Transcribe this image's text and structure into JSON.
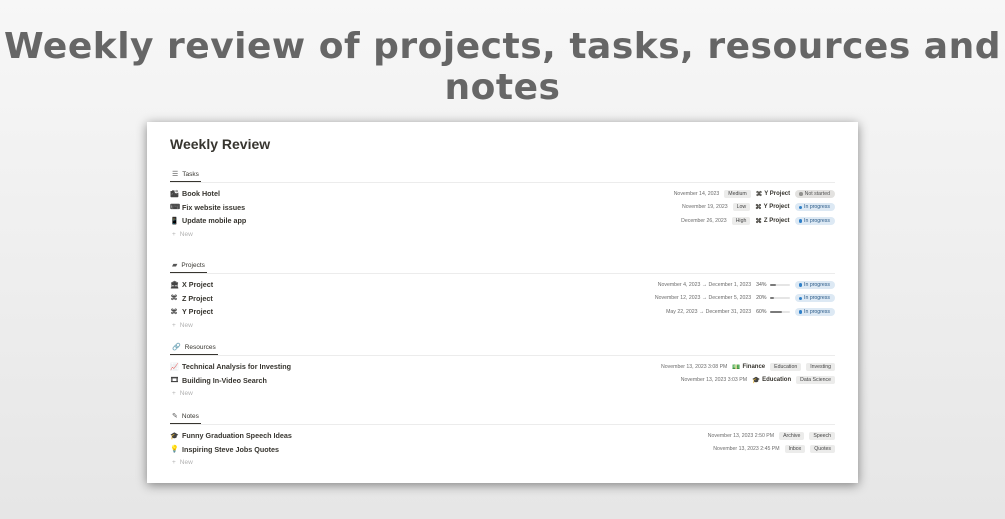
{
  "headline": "Weekly review of projects, tasks, resources and notes",
  "page_title": "Weekly Review",
  "new_label": "New",
  "tasks": {
    "tab_label": "Tasks",
    "rows": [
      {
        "name": "Book Hotel",
        "icon": "building-icon",
        "glyph": "🏙",
        "date": "November 14, 2023",
        "priority": "Medium",
        "project": "Y Project",
        "status": "Not started",
        "status_kind": "grey"
      },
      {
        "name": "Fix website issues",
        "icon": "keyboard-icon",
        "glyph": "⌨",
        "date": "November 19, 2023",
        "priority": "Low",
        "project": "Y Project",
        "status": "In progress",
        "status_kind": "blue"
      },
      {
        "name": "Update mobile app",
        "icon": "phone-icon",
        "glyph": "📱",
        "date": "December 26, 2023",
        "priority": "High",
        "project": "Z Project",
        "status": "In progress",
        "status_kind": "blue"
      }
    ]
  },
  "projects": {
    "tab_label": "Projects",
    "rows": [
      {
        "name": "X Project",
        "icon": "bank-icon",
        "glyph": "🏛",
        "dates": "November 4, 2023 → December 1, 2023",
        "progress_label": "34%",
        "progress": 0.34,
        "status": "In progress"
      },
      {
        "name": "Z Project",
        "icon": "command-icon",
        "glyph": "⌘",
        "dates": "November 12, 2023 → December 5, 2023",
        "progress_label": "20%",
        "progress": 0.2,
        "status": "In progress"
      },
      {
        "name": "Y Project",
        "icon": "command-icon",
        "glyph": "⌘",
        "dates": "May 22, 2023 → December 31, 2023",
        "progress_label": "60%",
        "progress": 0.6,
        "status": "In progress"
      }
    ]
  },
  "resources": {
    "tab_label": "Resources",
    "rows": [
      {
        "name": "Technical Analysis for Investing",
        "icon": "chart-icon",
        "glyph": "📈",
        "date": "November 13, 2023 3:08 PM",
        "area": "Finance",
        "area_icon": "money-icon",
        "area_glyph": "💵",
        "tags": [
          "Education",
          "Investing"
        ]
      },
      {
        "name": "Building In-Video Search",
        "icon": "film-icon",
        "glyph": "🎞",
        "date": "November 13, 2023 3:03 PM",
        "area": "Education",
        "area_icon": "graduation-cap-icon",
        "area_glyph": "🎓",
        "tags": [
          "Data Science"
        ]
      }
    ]
  },
  "notes": {
    "tab_label": "Notes",
    "rows": [
      {
        "name": "Funny Graduation Speech Ideas",
        "icon": "graduation-cap-icon",
        "glyph": "🎓",
        "date": "November 13, 2023 2:50 PM",
        "tags": [
          "Archive",
          "Speech"
        ]
      },
      {
        "name": "Inspiring Steve Jobs Quotes",
        "icon": "lightbulb-icon",
        "glyph": "💡",
        "date": "November 13, 2023 2:45 PM",
        "tags": [
          "Inbox",
          "Quotes"
        ]
      }
    ]
  }
}
